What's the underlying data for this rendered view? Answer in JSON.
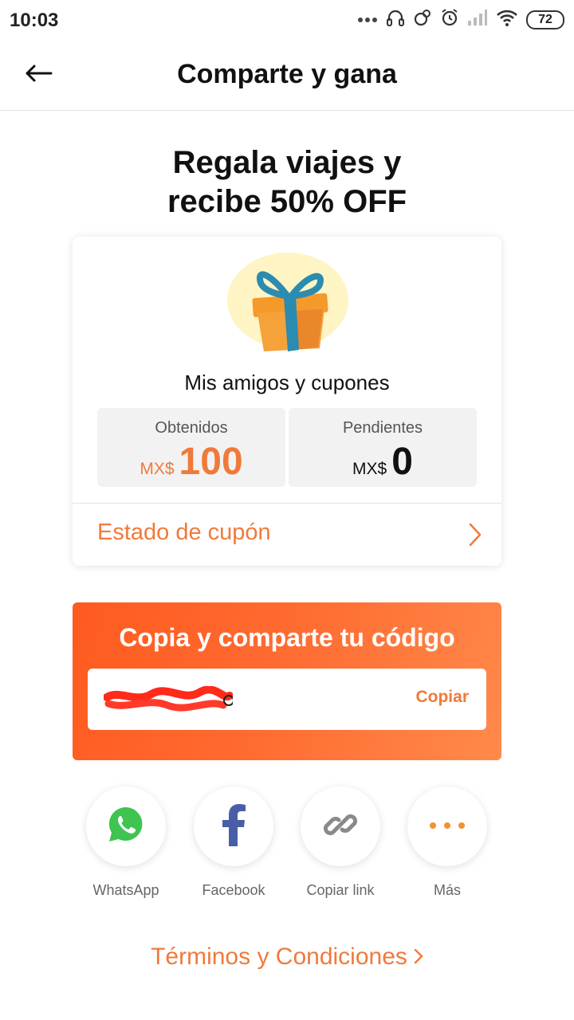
{
  "status_bar": {
    "time": "10:03",
    "battery": "72",
    "icons": [
      "more-dots-icon",
      "headphones-icon",
      "sync-icon",
      "alarm-icon",
      "signal-icon",
      "wifi-icon",
      "battery-icon"
    ]
  },
  "header": {
    "title": "Comparte y gana",
    "back_icon": "arrow-left-icon"
  },
  "hero": {
    "title_line1": "Regala viajes y",
    "title_line2": "recibe 50% OFF"
  },
  "card": {
    "subtitle": "Mis amigos y cupones",
    "earned": {
      "label": "Obtenidos",
      "currency": "MX$",
      "amount": "100"
    },
    "pending": {
      "label": "Pendientes",
      "currency": "MX$",
      "amount": "0"
    },
    "coupon_status_link": "Estado de cupón"
  },
  "share_code": {
    "title": "Copia y comparte tu código",
    "copy_label": "Copiar"
  },
  "share_options": [
    {
      "label": "WhatsApp",
      "icon": "whatsapp-icon"
    },
    {
      "label": "Facebook",
      "icon": "facebook-icon"
    },
    {
      "label": "Copiar link",
      "icon": "link-icon"
    },
    {
      "label": "Más",
      "icon": "more-dots-icon"
    }
  ],
  "terms_link": "Términos y Condiciones",
  "colors": {
    "accent": "#f07a3a",
    "panel_start": "#ff5a1f",
    "panel_end": "#ff8a4a",
    "whatsapp": "#3fc351",
    "facebook": "#4a5ea7"
  }
}
